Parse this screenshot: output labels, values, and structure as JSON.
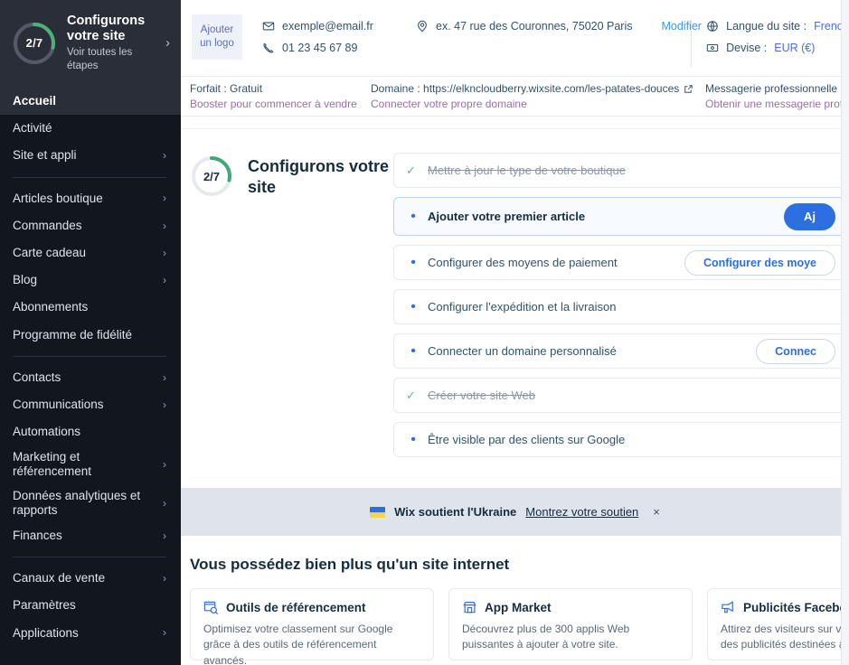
{
  "sidebar": {
    "setup_banner": {
      "progress_label": "2/7",
      "progress_current": 2,
      "progress_total": 7,
      "title": "Configurons votre site",
      "subtitle": "Voir toutes les étapes",
      "chevron": "›",
      "ring_color": "#4caf7d",
      "ring_track_color": "#555b66"
    },
    "items": [
      {
        "label": "Accueil",
        "active": true,
        "chevron": ""
      },
      {
        "label": "Activité",
        "active": false,
        "chevron": ""
      },
      {
        "label": "Site et appli",
        "active": false,
        "chevron": "›"
      },
      {
        "separator": true
      },
      {
        "label": "Articles boutique",
        "active": false,
        "chevron": "›"
      },
      {
        "label": "Commandes",
        "active": false,
        "chevron": "›"
      },
      {
        "label": "Carte cadeau",
        "active": false,
        "chevron": "›"
      },
      {
        "label": "Blog",
        "active": false,
        "chevron": "›"
      },
      {
        "label": "Abonnements",
        "active": false,
        "chevron": ""
      },
      {
        "label": "Programme de fidélité",
        "active": false,
        "chevron": ""
      },
      {
        "separator": true
      },
      {
        "label": "Contacts",
        "active": false,
        "chevron": "›"
      },
      {
        "label": "Communications",
        "active": false,
        "chevron": "›"
      },
      {
        "label": "Automations",
        "active": false,
        "chevron": ""
      },
      {
        "label": "Marketing et référencement",
        "active": false,
        "chevron": "›",
        "two_line": true
      },
      {
        "label": "Données analytiques et rapports",
        "active": false,
        "chevron": "›",
        "two_line": true
      },
      {
        "label": "Finances",
        "active": false,
        "chevron": "›"
      },
      {
        "separator": true
      },
      {
        "label": "Canaux de vente",
        "active": false,
        "chevron": "›"
      },
      {
        "label": "Paramètres",
        "active": false,
        "chevron": ""
      },
      {
        "label": "Applications",
        "active": false,
        "chevron": "›"
      }
    ]
  },
  "topbar": {
    "logo_line1": "Ajouter",
    "logo_line2": "un logo",
    "email": "exemple@email.fr",
    "phone": "01 23 45 67 89",
    "address": "ex. 47 rue des Couronnes, 75020 Paris",
    "edit_label": "Modifier",
    "language_label": "Langue du site :",
    "language_value": "French",
    "currency_label": "Devise :",
    "currency_value": "EUR (€)"
  },
  "statusbar": {
    "plan_label": "Forfait : Gratuit",
    "plan_link": "Booster pour commencer à vendre",
    "domain_label": "Domaine : https://elkncloudberry.wixsite.com/les-patates-douces",
    "domain_link": "Connecter votre propre domaine",
    "mailbox_label": "Messagerie professionnelle : N",
    "mailbox_link": "Obtenir une messagerie profes"
  },
  "setup_panel": {
    "progress_label": "2/7",
    "progress_current": 2,
    "progress_total": 7,
    "title": "Configurons votre site",
    "ring_color": "#3fa878",
    "ring_track_color": "#e6e9ee",
    "tasks": [
      {
        "label": "Mettre à jour le type de votre boutique",
        "state": "done",
        "marker": "✓",
        "button": null,
        "highlight": false
      },
      {
        "label": "Ajouter votre premier article",
        "state": "active",
        "marker": "•",
        "button": "Aj",
        "button_style": "primary",
        "highlight": true
      },
      {
        "label": "Configurer des moyens de paiement",
        "state": "todo",
        "marker": "•",
        "button": "Configurer des moye",
        "button_style": "secondary",
        "highlight": false
      },
      {
        "label": "Configurer l'expédition et la livraison",
        "state": "todo",
        "marker": "•",
        "button": null,
        "highlight": false
      },
      {
        "label": "Connecter un domaine personnalisé",
        "state": "todo",
        "marker": "•",
        "button": "Connec",
        "button_style": "secondary",
        "highlight": false
      },
      {
        "label": "Créer votre site Web",
        "state": "done",
        "marker": "✓",
        "button": null,
        "highlight": false
      },
      {
        "label": "Être visible par des clients sur Google",
        "state": "todo",
        "marker": "•",
        "button": null,
        "highlight": false
      }
    ]
  },
  "ukraine_banner": {
    "text": "Wix soutient l'Ukraine",
    "link": "Montrez votre soutien",
    "close": "×",
    "background": "#dfe3ec"
  },
  "more_section": {
    "title": "Vous possédez bien plus qu'un site internet",
    "cards": [
      {
        "icon": "seo-search-icon",
        "title": "Outils de référencement",
        "desc": "Optimisez votre classement sur Google grâce à des outils de référencement avancés."
      },
      {
        "icon": "app-market-icon",
        "title": "App Market",
        "desc": "Découvrez plus de 300 applis Web puissantes à ajouter à votre site."
      },
      {
        "icon": "megaphone-icon",
        "title": "Publicités Facebook",
        "desc": "Attirez des visiteurs sur votre site grâce à des publicités destinées à la bon"
      }
    ]
  }
}
